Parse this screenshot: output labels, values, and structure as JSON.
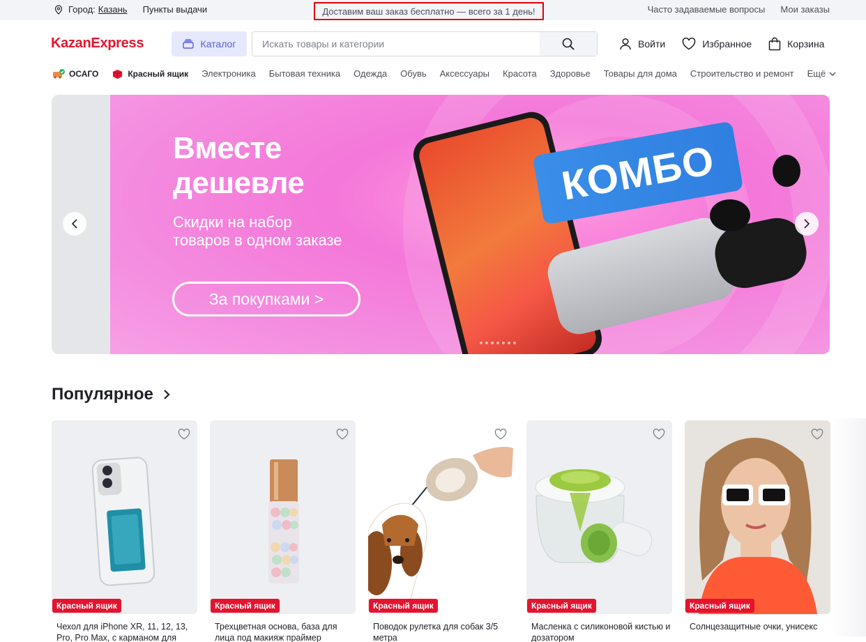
{
  "topbar": {
    "city_label": "Город:",
    "city_value": "Казань",
    "pickup_points": "Пункты выдачи",
    "promo": "Доставим ваш заказ бесплатно — всего за 1 день!",
    "faq": "Часто задаваемые вопросы",
    "my_orders": "Мои заказы"
  },
  "header": {
    "logo": "KazanExpress",
    "catalog": "Каталог",
    "search_placeholder": "Искать товары и категории",
    "login": "Войти",
    "favorites": "Избранное",
    "cart": "Корзина"
  },
  "nav": {
    "special": [
      "ОСАГО",
      "Красный ящик"
    ],
    "items": [
      "Электроника",
      "Бытовая техника",
      "Одежда",
      "Обувь",
      "Аксессуары",
      "Красота",
      "Здоровье",
      "Товары для дома",
      "Строительство и ремонт"
    ],
    "more": "Ещё"
  },
  "banner": {
    "title_line1": "Вместе",
    "title_line2": "дешевле",
    "subtitle_line1": "Скидки на набор",
    "subtitle_line2": "товаров в одном заказе",
    "button": "За покупками >",
    "badge": "КОМБО"
  },
  "popular": {
    "title": "Популярное",
    "cards": [
      {
        "badge": "Красный ящик",
        "title": "Чехол для iPhone XR, 11, 12, 13, Pro, Pro Max, с карманом для"
      },
      {
        "badge": "Красный ящик",
        "title": "Трехцветная основа, база для лица под макияж праймер"
      },
      {
        "badge": "Красный ящик",
        "title": "Поводок рулетка для собак 3/5 метра"
      },
      {
        "badge": "Красный ящик",
        "title": "Масленка с силиконовой кистью и дозатором"
      },
      {
        "badge": "Красный ящик",
        "title": "Солнцезащитные очки, унисекс"
      }
    ]
  },
  "colors": {
    "brand": "#e5142e",
    "catalog_accent": "#5b5fd7",
    "banner_pink": "#f477d9",
    "combo_blue": "#3a8ee8"
  }
}
